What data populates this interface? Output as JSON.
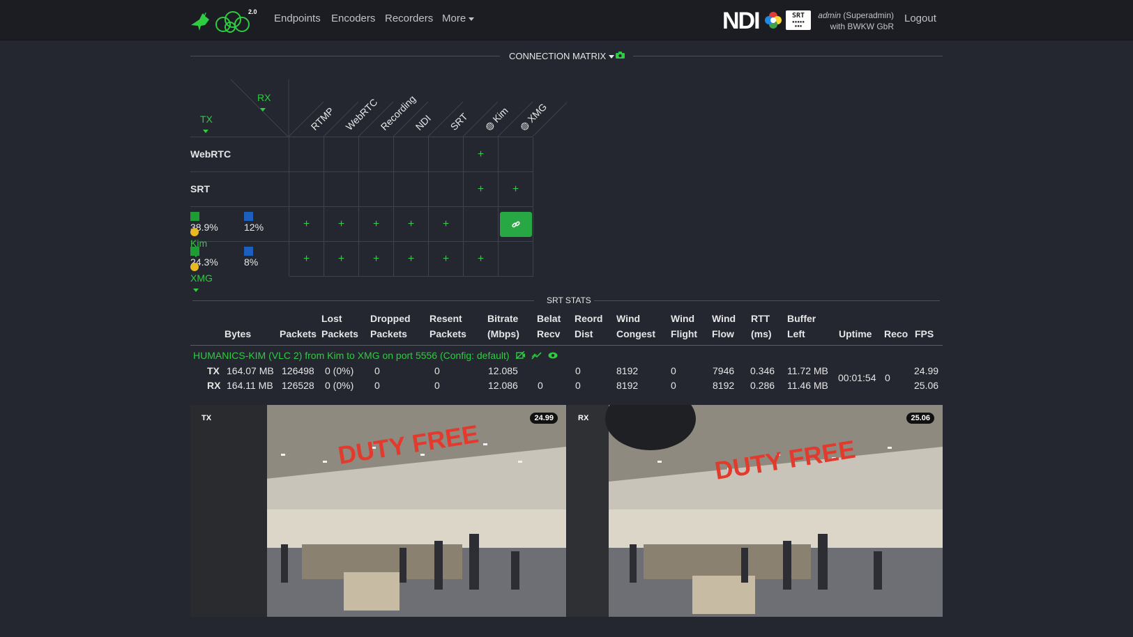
{
  "nav": {
    "version": "2.0",
    "links": [
      "Endpoints",
      "Encoders",
      "Recorders",
      "More"
    ],
    "ndi": "NDI",
    "srt_logo": "SRT",
    "user_name": "admin",
    "user_role": "(Superadmin)",
    "user_org": "with BWKW GbR",
    "logout": "Logout"
  },
  "matrix": {
    "title": "CONNECTION MATRIX",
    "rx_label": "RX",
    "tx_label": "TX",
    "columns": [
      "RTMP",
      "WebRTC",
      "Recording",
      "NDI",
      "SRT",
      "Kim",
      "XMG"
    ],
    "rows": [
      {
        "label": "WebRTC",
        "cells": [
          "",
          "",
          "",
          "",
          "",
          "+",
          ""
        ]
      },
      {
        "label": "SRT",
        "cells": [
          "",
          "",
          "",
          "",
          "",
          "+",
          "+"
        ]
      },
      {
        "label": "Kim",
        "cpu": "38.9%",
        "mem": "12%",
        "cells": [
          "+",
          "+",
          "+",
          "+",
          "+",
          "",
          "link"
        ]
      },
      {
        "label": "XMG",
        "cpu": "24.3%",
        "mem": "8%",
        "cells": [
          "+",
          "+",
          "+",
          "+",
          "+",
          "+",
          ""
        ]
      }
    ],
    "colors": {
      "cpu": "#1f9d35",
      "mem": "#1d5fbf",
      "accent": "#2ecc40"
    }
  },
  "stats": {
    "title": "SRT STATS",
    "headers": [
      [
        "",
        "Bytes"
      ],
      [
        "",
        "Packets"
      ],
      [
        "Lost",
        "Packets"
      ],
      [
        "Dropped",
        "Packets"
      ],
      [
        "Resent",
        "Packets"
      ],
      [
        "Bitrate",
        "(Mbps)"
      ],
      [
        "Belat",
        "Recv"
      ],
      [
        "Reord",
        "Dist"
      ],
      [
        "Wind",
        "Congest"
      ],
      [
        "Wind",
        "Flight"
      ],
      [
        "Wind",
        "Flow"
      ],
      [
        "RTT",
        "(ms)"
      ],
      [
        "Buffer",
        "Left"
      ],
      [
        "",
        "Uptime"
      ],
      [
        "",
        "Reco"
      ],
      [
        "",
        "FPS"
      ]
    ],
    "stream": "HUMANICS-KIM (VLC 2) from Kim to XMG on port 5556 (Config: default)",
    "tx": {
      "label": "TX",
      "bytes": "164.07 MB",
      "packets": "126498",
      "lost": "0 (0%)",
      "dropped": "0",
      "resent": "0",
      "bitrate": "12.085",
      "belat": "",
      "reord": "0",
      "congest": "8192",
      "flight": "0",
      "flow": "7946",
      "rtt": "0.346",
      "buffer": "11.72 MB",
      "fps": "24.99"
    },
    "rx": {
      "label": "RX",
      "bytes": "164.11 MB",
      "packets": "126528",
      "lost": "0 (0%)",
      "dropped": "0",
      "resent": "0",
      "bitrate": "12.086",
      "belat": "0",
      "reord": "0",
      "congest": "8192",
      "flight": "0",
      "flow": "8192",
      "rtt": "0.286",
      "buffer": "11.46 MB",
      "fps": "25.06"
    },
    "uptime": "00:01:54",
    "reco": "0"
  },
  "videos": {
    "tx": {
      "label": "TX",
      "fps": "24.99",
      "sign": "DUTY FREE"
    },
    "rx": {
      "label": "RX",
      "fps": "25.06",
      "sign": "DUTY FREE"
    }
  }
}
